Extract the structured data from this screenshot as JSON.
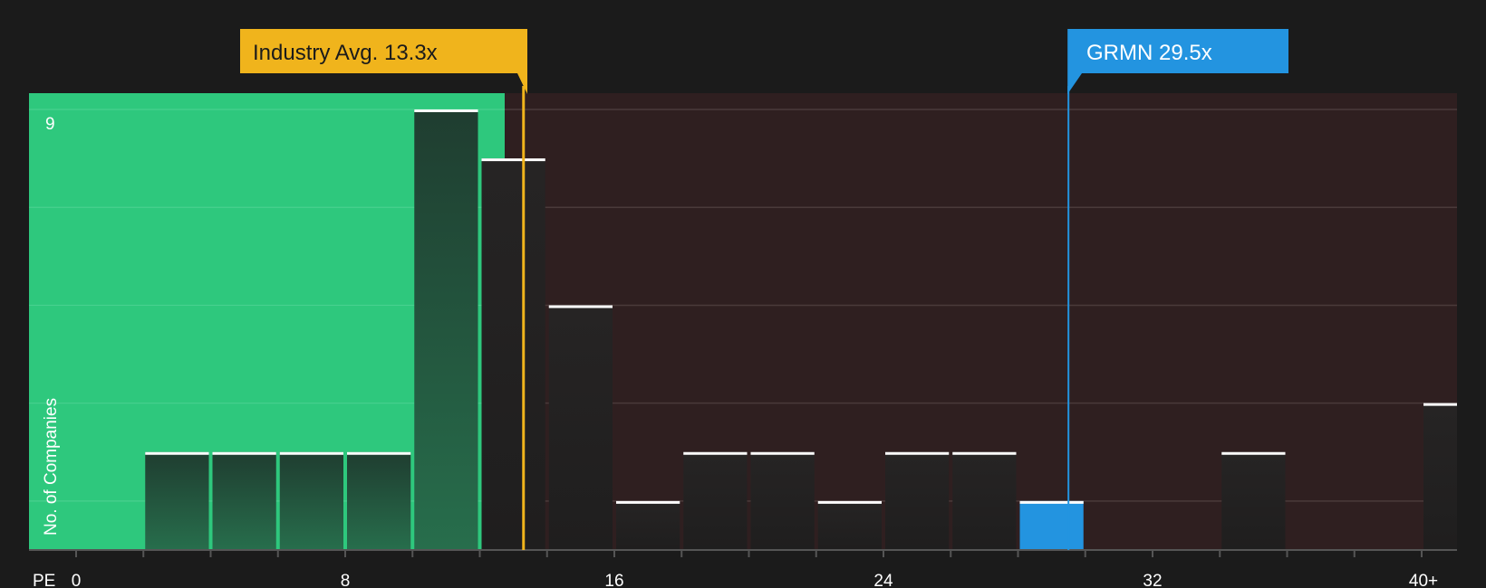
{
  "chart_data": {
    "type": "bar",
    "title": "",
    "xlabel": "PE",
    "ylabel": "No. of Companies",
    "x_ticks": [
      "0",
      "8",
      "16",
      "24",
      "32",
      "40+"
    ],
    "y_top_label": "9",
    "ylim": [
      0,
      9
    ],
    "xlim": [
      0,
      40
    ],
    "bin_width": 2,
    "bins": [
      {
        "start": 0,
        "value": 0
      },
      {
        "start": 2,
        "value": 2
      },
      {
        "start": 4,
        "value": 2
      },
      {
        "start": 6,
        "value": 2
      },
      {
        "start": 8,
        "value": 2
      },
      {
        "start": 10,
        "value": 9
      },
      {
        "start": 12,
        "value": 8
      },
      {
        "start": 14,
        "value": 5
      },
      {
        "start": 16,
        "value": 1
      },
      {
        "start": 18,
        "value": 2
      },
      {
        "start": 20,
        "value": 2
      },
      {
        "start": 22,
        "value": 1
      },
      {
        "start": 24,
        "value": 2
      },
      {
        "start": 26,
        "value": 2
      },
      {
        "start": 28,
        "value": 1,
        "highlight": true
      },
      {
        "start": 30,
        "value": 0
      },
      {
        "start": 32,
        "value": 0
      },
      {
        "start": 34,
        "value": 2
      },
      {
        "start": 36,
        "value": 0
      },
      {
        "start": 38,
        "value": 0
      },
      {
        "start": 40,
        "value": 3
      }
    ],
    "industry_avg": {
      "label": "Industry Avg. 13.3x",
      "value": 13.3
    },
    "company": {
      "label": "GRMN 29.5x",
      "value": 29.5
    },
    "colors": {
      "background": "#1b1b1b",
      "good_zone": "#2ec87d",
      "bad_zone": "#2f1f20",
      "bar_dark": "#232323",
      "bar_green_dark": "#1f4a37",
      "highlight": "#2394e0",
      "industry": "#f0b41c",
      "bar_top": "#ffffff",
      "axis": "#555555"
    }
  }
}
